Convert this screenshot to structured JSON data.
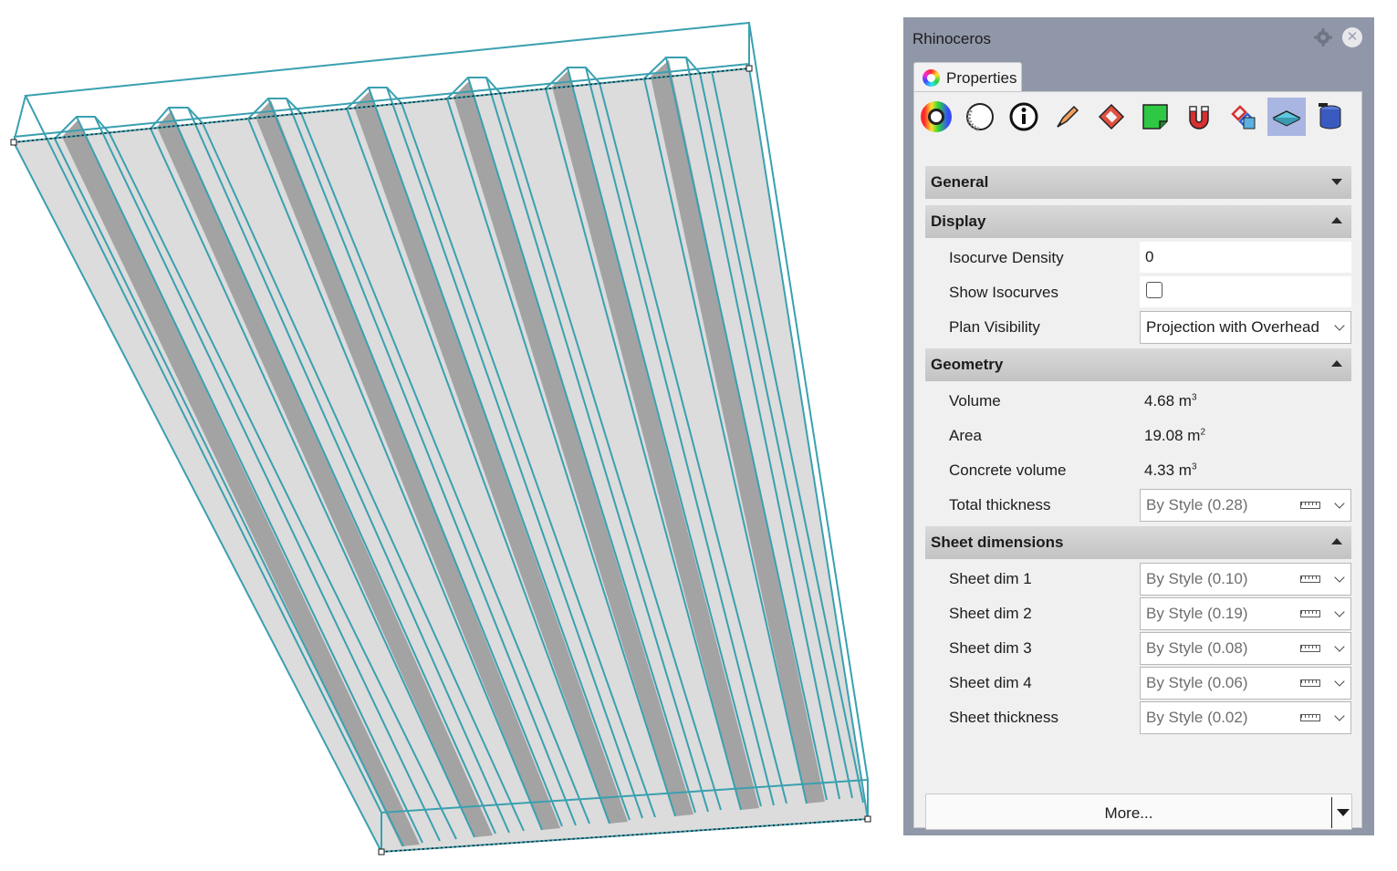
{
  "panel": {
    "title": "Rhinoceros"
  },
  "tab": {
    "label": "Properties"
  },
  "toolbar": {
    "icons": [
      "color-wheel-icon",
      "material-icon",
      "info-icon",
      "pen-icon",
      "texture-icon",
      "sticky-note-icon",
      "magnet-icon",
      "link-icon",
      "slab-icon",
      "database-icon"
    ],
    "active_index": 8
  },
  "sections": {
    "general": {
      "label": "General",
      "expanded": false
    },
    "display": {
      "label": "Display",
      "expanded": true
    },
    "geometry": {
      "label": "Geometry",
      "expanded": true
    },
    "sheet": {
      "label": "Sheet dimensions",
      "expanded": true
    }
  },
  "display": {
    "isocurve_density": {
      "label": "Isocurve Density",
      "value": "0"
    },
    "show_isocurves": {
      "label": "Show Isocurves",
      "checked": false
    },
    "plan_visibility": {
      "label": "Plan Visibility",
      "value": "Projection with Overhead"
    }
  },
  "geometry": {
    "volume": {
      "label": "Volume",
      "value": "4.68 m",
      "unit_exp": "3"
    },
    "area": {
      "label": "Area",
      "value": "19.08 m",
      "unit_exp": "2"
    },
    "concrete_volume": {
      "label": "Concrete volume",
      "value": "4.33 m",
      "unit_exp": "3"
    },
    "total_thickness": {
      "label": "Total thickness",
      "value": "By Style (0.28)"
    }
  },
  "sheet": {
    "dim1": {
      "label": "Sheet dim 1",
      "value": "By Style (0.10)"
    },
    "dim2": {
      "label": "Sheet dim 2",
      "value": "By Style (0.19)"
    },
    "dim3": {
      "label": "Sheet dim 3",
      "value": "By Style (0.08)"
    },
    "dim4": {
      "label": "Sheet dim 4",
      "value": "By Style (0.06)"
    },
    "thickness": {
      "label": "Sheet thickness",
      "value": "By Style (0.02)"
    }
  },
  "more_button": {
    "label": "More..."
  },
  "colors": {
    "selection": "#3aa0b0",
    "panel_bg": "#9097a8",
    "section": "#c8c8c8",
    "active_tool": "#a9b6e2"
  }
}
